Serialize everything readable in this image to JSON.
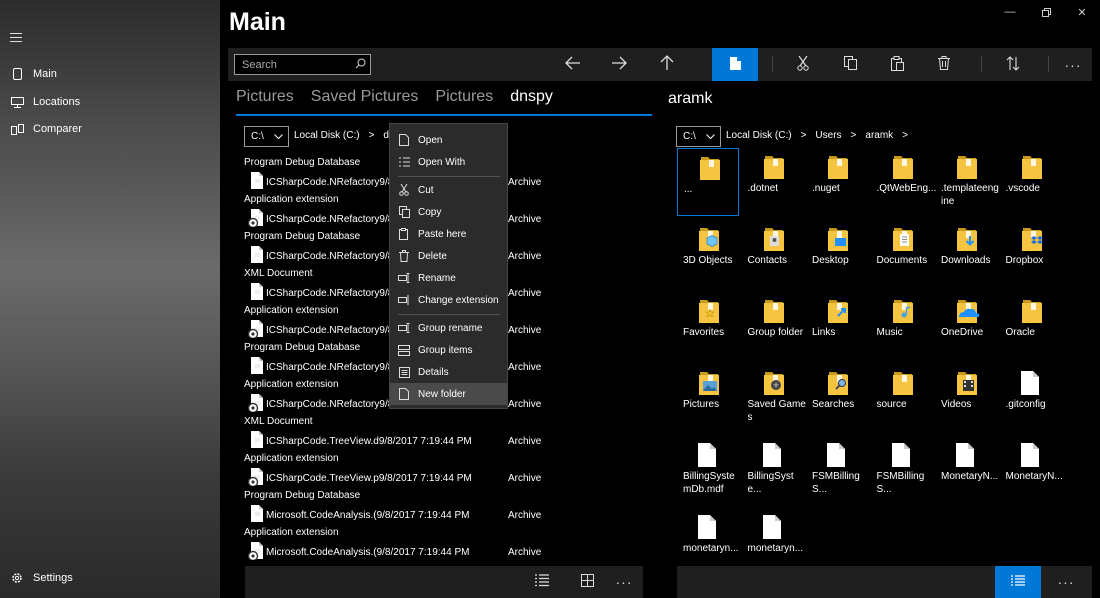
{
  "sidebar": {
    "items": [
      {
        "label": "Main",
        "icon": "phone-icon"
      },
      {
        "label": "Locations",
        "icon": "monitor-icon"
      },
      {
        "label": "Comparer",
        "icon": "compare-icon"
      }
    ],
    "settings_label": "Settings"
  },
  "app": {
    "title": "Main"
  },
  "toolbar": {
    "search_placeholder": "Search"
  },
  "tabs": [
    "Pictures",
    "Saved Pictures",
    "Pictures",
    "dnspy"
  ],
  "left_pane": {
    "drive": "C:\\",
    "crumbs": [
      "Local Disk (C:)",
      ">",
      "dev"
    ],
    "rows": [
      {
        "type": "Program Debug Database",
        "name": "ICSharpCode.NRefactory9/8",
        "attr": "Archive"
      },
      {
        "type": "Application extension",
        "name": "ICSharpCode.NRefactory9/8",
        "attr": "Archive"
      },
      {
        "type": "Program Debug Database",
        "name": "ICSharpCode.NRefactory9/8",
        "attr": "Archive"
      },
      {
        "type": "XML Document",
        "name": "ICSharpCode.NRefactory9/8",
        "attr": "Archive"
      },
      {
        "type": "Application extension",
        "name": "ICSharpCode.NRefactory9/8",
        "attr": "Archive"
      },
      {
        "type": "Program Debug Database",
        "name": "ICSharpCode.NRefactory9/8",
        "attr": "Archive"
      },
      {
        "type": "Application extension",
        "name": "ICSharpCode.NRefactory9/8",
        "attr": "Archive"
      },
      {
        "type": "XML Document",
        "name": "ICSharpCode.TreeView.d9/8/2017 7:19:44 PM",
        "attr": "Archive"
      },
      {
        "type": "Application extension",
        "name": "ICSharpCode.TreeView.p9/8/2017 7:19:44 PM",
        "attr": "Archive"
      },
      {
        "type": "Program Debug Database",
        "name": "Microsoft.CodeAnalysis.(9/8/2017 7:19:44 PM",
        "attr": "Archive"
      },
      {
        "type": "Application extension",
        "name": "Microsoft.CodeAnalysis.(9/8/2017 7:19:44 PM",
        "attr": "Archive"
      }
    ]
  },
  "right_pane": {
    "title": "aramk",
    "drive": "C:\\",
    "crumbs": [
      "Local Disk (C:)",
      ">",
      "Users",
      ">",
      "aramk",
      ">"
    ],
    "tiles": [
      {
        "label": "...",
        "icon": "folder-icon"
      },
      {
        "label": ".dotnet",
        "icon": "folder-icon"
      },
      {
        "label": ".nuget",
        "icon": "folder-icon"
      },
      {
        "label": ".QtWebEng...",
        "icon": "folder-icon"
      },
      {
        "label": ".templateengine",
        "icon": "folder-icon"
      },
      {
        "label": ".vscode",
        "icon": "folder-icon"
      },
      {
        "label": "3D Objects",
        "icon": "3d-folder-icon"
      },
      {
        "label": "Contacts",
        "icon": "contacts-folder-icon"
      },
      {
        "label": "Desktop",
        "icon": "desktop-folder-icon"
      },
      {
        "label": "Documents",
        "icon": "documents-folder-icon"
      },
      {
        "label": "Downloads",
        "icon": "downloads-folder-icon"
      },
      {
        "label": "Dropbox",
        "icon": "dropbox-folder-icon"
      },
      {
        "label": "Favorites",
        "icon": "favorites-folder-icon"
      },
      {
        "label": "Group folder",
        "icon": "folder-icon"
      },
      {
        "label": "Links",
        "icon": "links-folder-icon"
      },
      {
        "label": "Music",
        "icon": "music-folder-icon"
      },
      {
        "label": "OneDrive",
        "icon": "onedrive-folder-icon"
      },
      {
        "label": "Oracle",
        "icon": "folder-icon"
      },
      {
        "label": "Pictures",
        "icon": "pictures-folder-icon"
      },
      {
        "label": "Saved Games",
        "icon": "saved-games-folder-icon"
      },
      {
        "label": "Searches",
        "icon": "searches-folder-icon"
      },
      {
        "label": "source",
        "icon": "folder-icon"
      },
      {
        "label": "Videos",
        "icon": "videos-folder-icon"
      },
      {
        "label": ".gitconfig",
        "icon": "file-icon"
      },
      {
        "label": "BillingSystemDb.mdf",
        "icon": "file-icon"
      },
      {
        "label": "BillingSyste...",
        "icon": "file-icon"
      },
      {
        "label": "FSMBillingS...",
        "icon": "file-icon"
      },
      {
        "label": "FSMBillingS...",
        "icon": "file-icon"
      },
      {
        "label": "MonetaryN...",
        "icon": "file-icon"
      },
      {
        "label": "MonetaryN...",
        "icon": "file-icon"
      },
      {
        "label": "monetaryn...",
        "icon": "file-icon"
      },
      {
        "label": "monetaryn...",
        "icon": "file-icon"
      }
    ]
  },
  "context_menu": {
    "items": [
      {
        "label": "Open",
        "icon": "open-icon"
      },
      {
        "label": "Open With",
        "icon": "open-with-icon"
      },
      {
        "label": "Cut",
        "icon": "cut-icon"
      },
      {
        "label": "Copy",
        "icon": "copy-icon"
      },
      {
        "label": "Paste here",
        "icon": "paste-icon"
      },
      {
        "label": "Delete",
        "icon": "delete-icon"
      },
      {
        "label": "Rename",
        "icon": "rename-icon"
      },
      {
        "label": "Change extension",
        "icon": "change-extension-icon"
      },
      {
        "label": "Group rename",
        "icon": "group-rename-icon"
      },
      {
        "label": "Group items",
        "icon": "group-items-icon"
      },
      {
        "label": "Details",
        "icon": "details-icon"
      },
      {
        "label": "New folder",
        "icon": "new-folder-icon"
      }
    ]
  },
  "colors": {
    "accent": "#0078d7",
    "folder": "#f5c542"
  }
}
